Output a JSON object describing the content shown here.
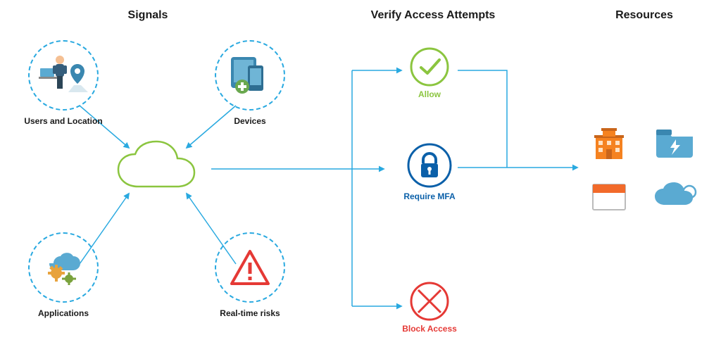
{
  "titles": {
    "signals": "Signals",
    "verify": "Verify Access Attempts",
    "resources": "Resources"
  },
  "signals": {
    "users_location": "Users and Location",
    "devices": "Devices",
    "applications": "Applications",
    "risks": "Real-time risks"
  },
  "verify": {
    "allow": "Allow",
    "mfa": "Require MFA",
    "block": "Block Access"
  },
  "colors": {
    "dash": "#29a9e0",
    "arrow": "#29a9e0",
    "cloud_border": "#8bc53f",
    "allow": "#8bc53f",
    "mfa_outline": "#0b60a9",
    "mfa_fill": "#0b60a9",
    "block": "#e53935",
    "orange": "#f58220",
    "blue_light": "#5aaad2",
    "blue_dark": "#3a87b0",
    "gray": "#777777"
  }
}
